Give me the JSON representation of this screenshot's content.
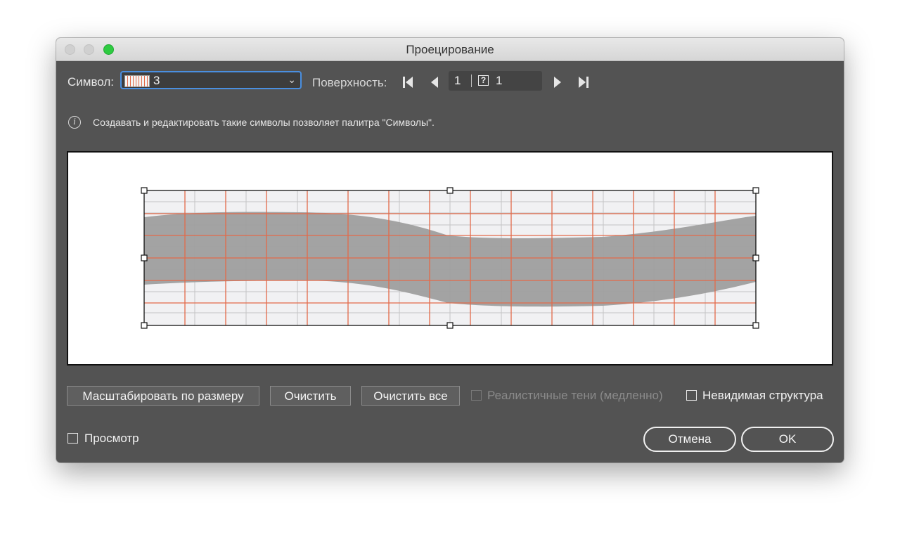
{
  "window": {
    "title": "Проецирование"
  },
  "toolbar": {
    "symbol_label": "Символ:",
    "symbol_value": "3",
    "surface_label": "Поверхность:",
    "surface_current": "1",
    "surface_total": "1",
    "unknown_mark": "?"
  },
  "info": {
    "text": "Создавать и редактировать такие символы позволяет палитра \"Символы\"."
  },
  "buttons": {
    "scale_to_fit": "Масштабировать по размеру",
    "clear": "Очистить",
    "clear_all": "Очистить все",
    "cancel": "Отмена",
    "ok": "OK"
  },
  "options": {
    "realistic_shadows": "Реалистичные тени (медленно)",
    "invisible_geometry": "Невидимая структура",
    "preview": "Просмотр"
  },
  "icons": {
    "first": "first-page-icon",
    "prev": "prev-page-icon",
    "next": "next-page-icon",
    "last": "last-page-icon",
    "info": "info-icon",
    "chevron": "chevron-down-icon"
  },
  "colors": {
    "panel": "#535353",
    "accent_focus": "#4a8fe0",
    "grid_orange": "#e36a4a",
    "grid_gray": "#c4c4c4",
    "band_gray": "#9e9e9e",
    "zoom_green": "#2ecb41"
  }
}
